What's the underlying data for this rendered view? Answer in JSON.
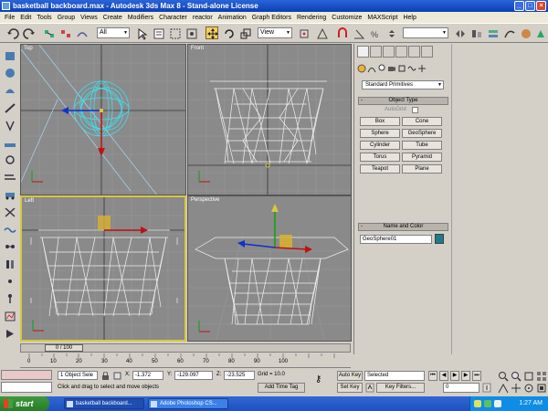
{
  "window": {
    "title": "basketball backboard.max - Autodesk 3ds Max 8 - Stand-alone License",
    "minimize": "_",
    "maximize": "□",
    "close": "×"
  },
  "menu": [
    "File",
    "Edit",
    "Tools",
    "Group",
    "Views",
    "Create",
    "Modifiers",
    "Character",
    "reactor",
    "Animation",
    "Graph Editors",
    "Rendering",
    "Customize",
    "MAXScript",
    "Help"
  ],
  "toolbar": {
    "selection_filter": "All",
    "ref_coord": "View",
    "named_selection": ""
  },
  "viewports": {
    "top": "Top",
    "front": "Front",
    "left": "Left",
    "perspective": "Perspective",
    "active": "left"
  },
  "command_panel": {
    "category": "Standard Primitives",
    "object_type_header": "Object Type",
    "autogrid": "AutoGrid",
    "buttons": [
      "Box",
      "Cone",
      "Sphere",
      "GeoSphere",
      "Cylinder",
      "Tube",
      "Torus",
      "Pyramid",
      "Teapot",
      "Plane"
    ],
    "name_color_header": "Name and Color",
    "object_name": "GeoSphere01",
    "object_color": "#1f7a8c"
  },
  "timeline": {
    "slider_label": "0 / 100",
    "ticks": [
      "0",
      "10",
      "20",
      "30",
      "40",
      "50",
      "60",
      "70",
      "80",
      "90",
      "100"
    ]
  },
  "status": {
    "selection_count": "1 Object Sele",
    "x_label": "X:",
    "x_value": "-1.372",
    "y_label": "Y:",
    "y_value": "-129.097",
    "z_label": "Z:",
    "z_value": "-23.525",
    "grid": "Grid = 10.0",
    "prompt": "Click and drag to select and move objects",
    "add_time_tag": "Add Time Tag",
    "auto_key": "Auto Key",
    "set_key": "Set Key",
    "key_mode": "Selected",
    "key_filters": "Key Filters...",
    "current_frame": "0"
  },
  "taskbar": {
    "start": "start",
    "tasks": [
      "basketball backboard...",
      "Adobe Photoshop CS..."
    ],
    "clock": "1:27 AM"
  }
}
